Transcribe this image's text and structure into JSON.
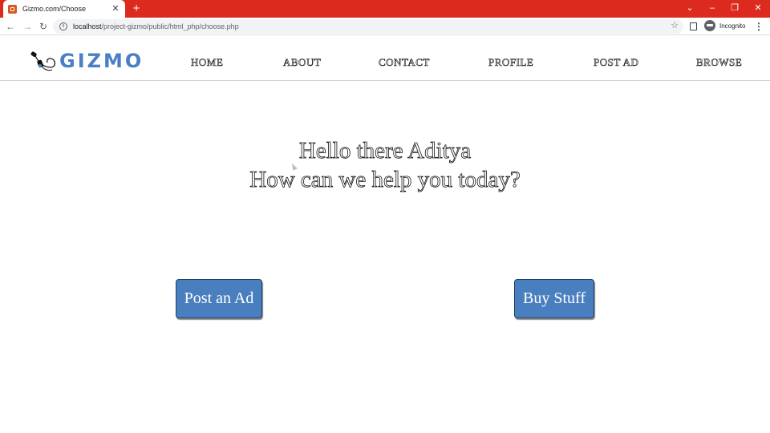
{
  "browser": {
    "tab_title": "Gizmo.com/Choose",
    "tab_close": "✕",
    "new_tab": "+",
    "url_host": "localhost",
    "url_path": "/project-gizmo/public/html_php/choose.php",
    "profile_label": "Incognito",
    "controls": {
      "back": "←",
      "forward": "→",
      "reload": "↻",
      "tab_search": "⌄",
      "minimize": "–",
      "restore": "❐",
      "close": "✕",
      "bookmark": "☆",
      "menu": "⋮",
      "info": "i"
    },
    "colors": {
      "tab_strip": "#dc2a1f"
    },
    "icons": [
      "back-arrow-icon",
      "forward-arrow-icon",
      "reload-icon",
      "info-icon",
      "bookmark-star-icon",
      "side-panel-icon",
      "incognito-icon",
      "menu-kebab-icon"
    ]
  },
  "site": {
    "logo_text": "GIZMO",
    "nav": [
      {
        "label": "HOME"
      },
      {
        "label": "ABOUT"
      },
      {
        "label": "CONTACT"
      },
      {
        "label": "PROFILE"
      },
      {
        "label": "POST AD"
      },
      {
        "label": "BROWSE"
      }
    ],
    "colors": {
      "brand": "#4a7fc4",
      "button": "#4a7fbf"
    }
  },
  "main": {
    "greeting_line1": "Hello there Aditya",
    "greeting_line2": "How can we help you today?",
    "post_ad_button": "Post an Ad",
    "buy_stuff_button": "Buy Stuff"
  }
}
